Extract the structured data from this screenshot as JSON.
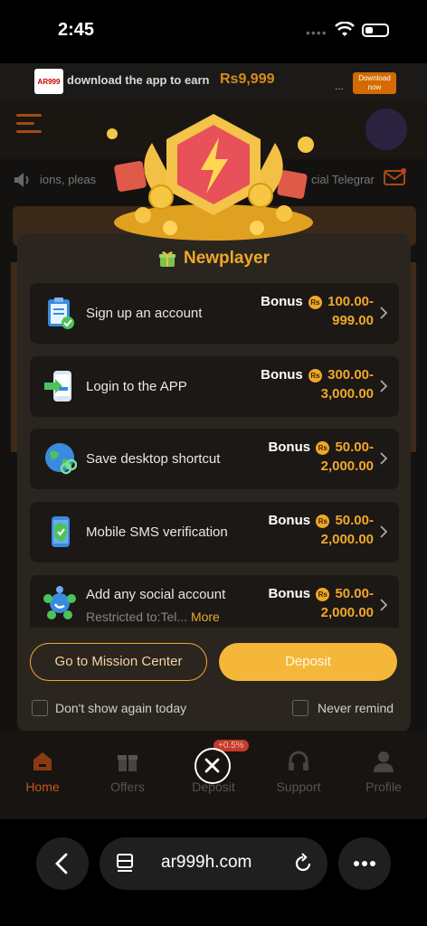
{
  "status_bar": {
    "time": "2:45"
  },
  "banner": {
    "logo_text": "AR999",
    "text": "download the app to earn",
    "amount": "Rs9,999",
    "ellipsis": "...",
    "button_label": "Download now"
  },
  "background": {
    "marquee_left": "ions, pleas",
    "marquee_right": "cial Telegrar"
  },
  "modal": {
    "title": "Newplayer",
    "bonus_label": "Bonus",
    "currency": "Rs",
    "items": [
      {
        "label": "Sign up an account",
        "amount_line1": "100.00-",
        "amount_line2": "999.00",
        "icon": "clipboard-check-icon"
      },
      {
        "label": "Login to the APP",
        "amount_line1": "300.00-",
        "amount_line2": "3,000.00",
        "icon": "phone-login-icon"
      },
      {
        "label": "Save desktop shortcut",
        "amount_line1": "50.00-",
        "amount_line2": "2,000.00",
        "icon": "globe-link-icon"
      },
      {
        "label": "Mobile SMS verification",
        "amount_line1": "50.00-",
        "amount_line2": "2,000.00",
        "icon": "shield-phone-icon"
      },
      {
        "label": "Add any social account",
        "sub": "Restricted to:Tel...",
        "more": "More",
        "amount_line1": "50.00-",
        "amount_line2": "2,000.00",
        "icon": "social-network-icon"
      }
    ],
    "mission_button": "Go to Mission Center",
    "deposit_button": "Deposit",
    "dont_show_today": "Don't show again today",
    "never_remind": "Never remind"
  },
  "bottom_nav": {
    "items": [
      {
        "label": "Home",
        "icon": "home-icon"
      },
      {
        "label": "Offers",
        "icon": "gift-icon"
      },
      {
        "label": "Deposit",
        "icon": "close-icon"
      },
      {
        "label": "Support",
        "icon": "headset-icon"
      },
      {
        "label": "Profile",
        "icon": "user-icon"
      }
    ],
    "deposit_badge": "+0.5%"
  },
  "browser": {
    "url": "ar999h.com"
  },
  "colors": {
    "accent": "#f0a829",
    "home_active": "#c9541a",
    "modal_bg": "#2b2520"
  }
}
